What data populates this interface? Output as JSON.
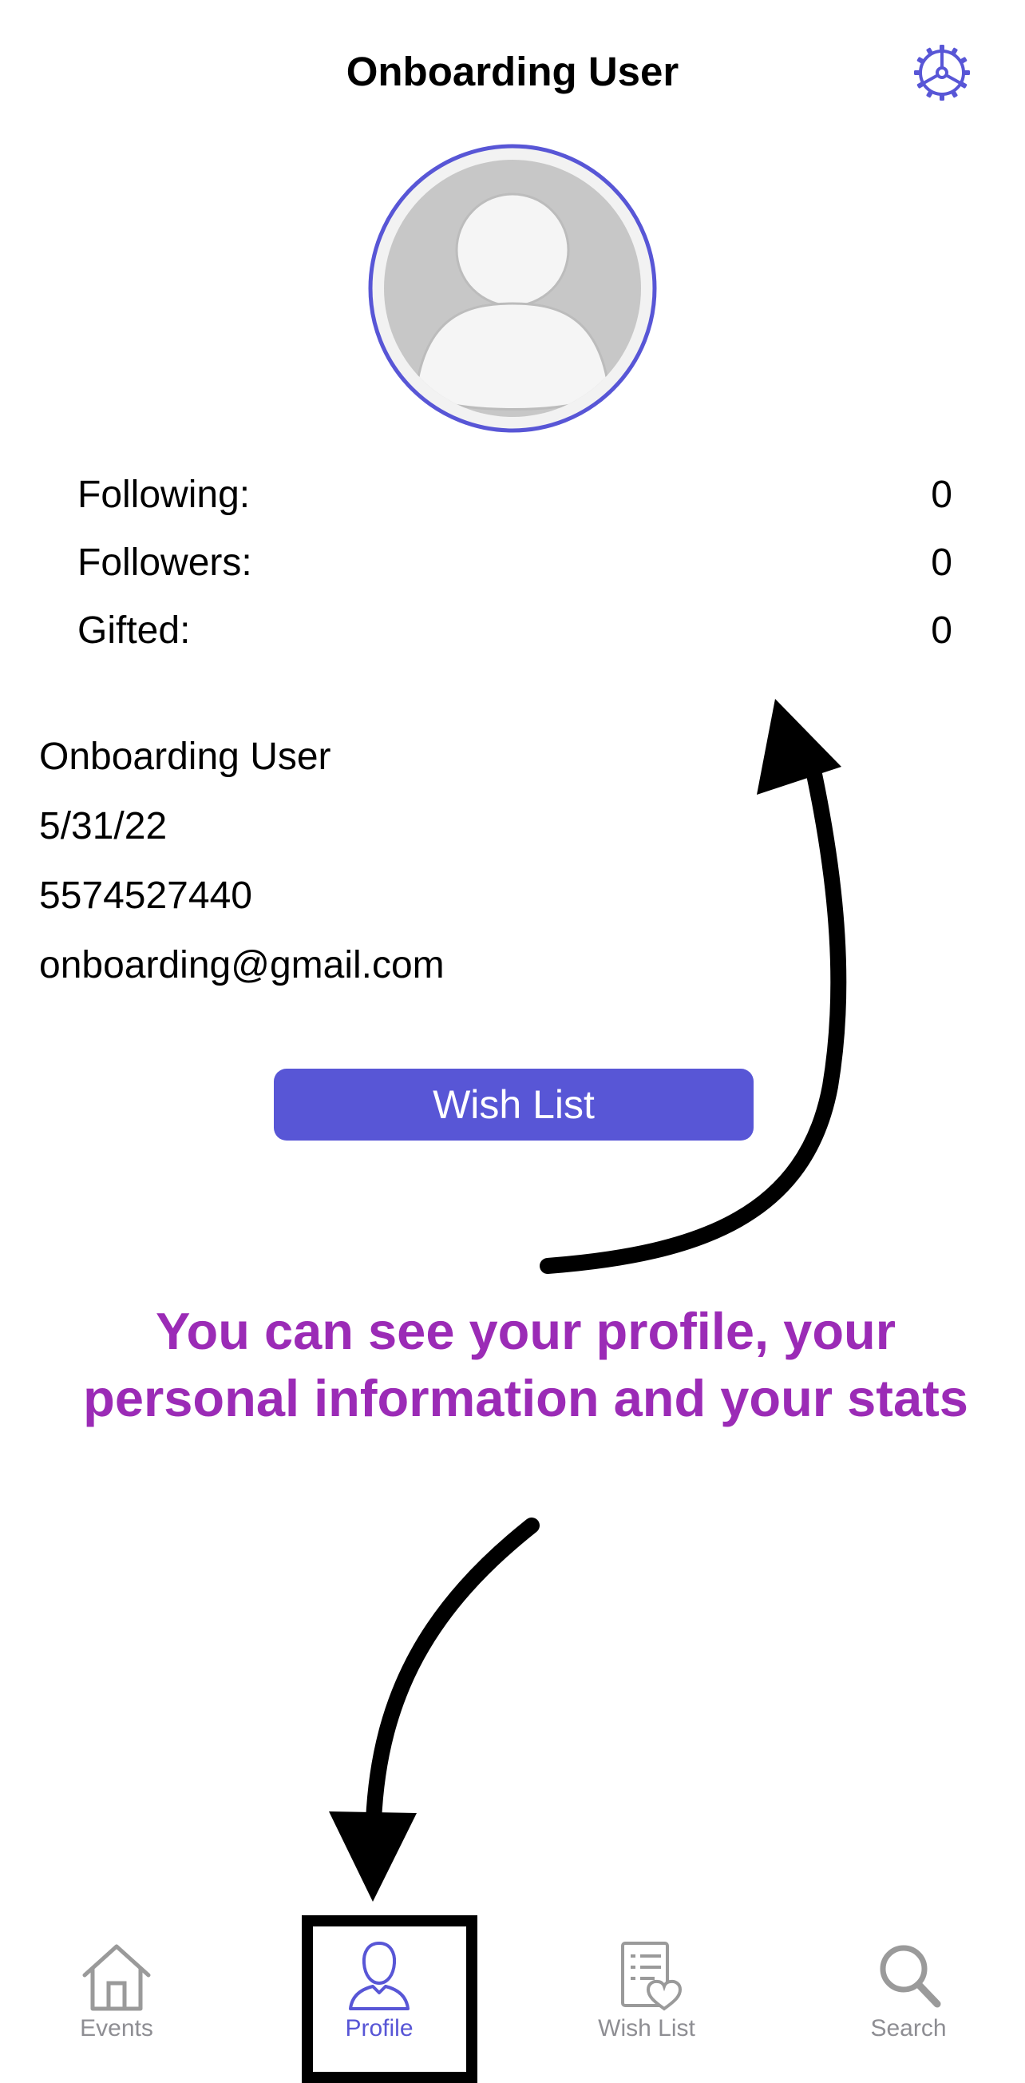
{
  "header": {
    "title": "Onboarding User"
  },
  "stats": [
    {
      "label": "Following:",
      "value": "0"
    },
    {
      "label": "Followers:",
      "value": "0"
    },
    {
      "label": "Gifted:",
      "value": "0"
    }
  ],
  "profile": {
    "name": "Onboarding User",
    "date": "5/31/22",
    "phone": "5574527440",
    "email": "onboarding@gmail.com"
  },
  "wish_list_button": {
    "label": "Wish List"
  },
  "annotation": {
    "text": "You can see your profile, your personal information and your stats"
  },
  "tab_bar": {
    "tabs": [
      {
        "label": "Events",
        "icon": "house-icon",
        "active": false
      },
      {
        "label": "Profile",
        "icon": "person-icon",
        "active": true
      },
      {
        "label": "Wish List",
        "icon": "wishlist-icon",
        "active": false
      },
      {
        "label": "Search",
        "icon": "search-icon",
        "active": false
      }
    ]
  },
  "colors": {
    "accent": "#5856d6",
    "annotation": "#9b2bb6",
    "inactive_tab": "#8e8e93",
    "avatar_fill": "#c7c7c7"
  }
}
